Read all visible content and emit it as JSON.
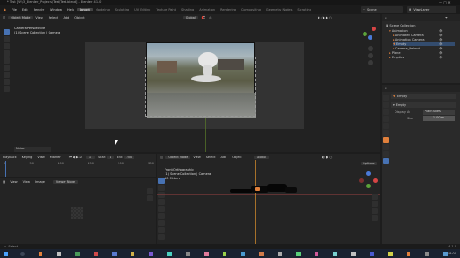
{
  "window": {
    "title": "* Test [W:\\3_Blender_Projects\\Test\\Test.blend] - Blender 4.1.0"
  },
  "workspace_tabs": [
    "Layout",
    "Modeling",
    "Sculpting",
    "UV Editing",
    "Texture Paint",
    "Shading",
    "Animation",
    "Rendering",
    "Compositing",
    "Geometry Nodes",
    "Scripting"
  ],
  "top_menu": [
    "File",
    "Edit",
    "Render",
    "Window",
    "Help"
  ],
  "scene": {
    "name": "Scene",
    "view_layer": "ViewLayer"
  },
  "viewport_top": {
    "mode": "Object Mode",
    "menus": [
      "View",
      "Select",
      "Add",
      "Object"
    ],
    "transform": "Global",
    "camera_label": "Camera Perspective",
    "collection_label": "(1) Scene Collection | Camera",
    "selection_label": "Noise"
  },
  "outliner": {
    "root": "Scene Collection",
    "items": [
      "Animation",
      "Animated Camera",
      "Animation Camera",
      "Empty",
      "Camera_Helmet",
      "Plane",
      "Empties"
    ]
  },
  "properties": {
    "object_name": "Empty",
    "section": "Empty",
    "display_as_label": "Display As",
    "display_as_value": "Plain Axes",
    "size_label": "Size",
    "size_value": "1.00 m"
  },
  "timeline": {
    "menus": [
      "Playback",
      "Keying",
      "View",
      "Marker"
    ],
    "frame_current": "1",
    "start_label": "Start",
    "start_value": "1",
    "end_label": "End",
    "end_value": "250",
    "ticks": [
      "0",
      "50",
      "100",
      "150",
      "200",
      "250"
    ]
  },
  "image_editor": {
    "menus": [
      "View",
      "View",
      "Image"
    ],
    "mode": "Viewer Node"
  },
  "viewport_bottom": {
    "mode": "Object Mode",
    "menus": [
      "View",
      "Select",
      "Add",
      "Object"
    ],
    "transform": "Global",
    "view_label": "Front Orthographic",
    "collection_label": "(1) Scene Collection | Camera",
    "unit_label": "10 Meters",
    "options_label": "Options"
  },
  "status_bar": {
    "select": "Select",
    "version": "4.1.0"
  },
  "taskbar": {
    "time": "18:00",
    "date": "01/01/2024"
  },
  "colors": {
    "accent": "#4772b3",
    "orange": "#e0803c",
    "panel": "#303030",
    "viewport": "#2b2b2b",
    "taskbar": "#1a2230"
  }
}
